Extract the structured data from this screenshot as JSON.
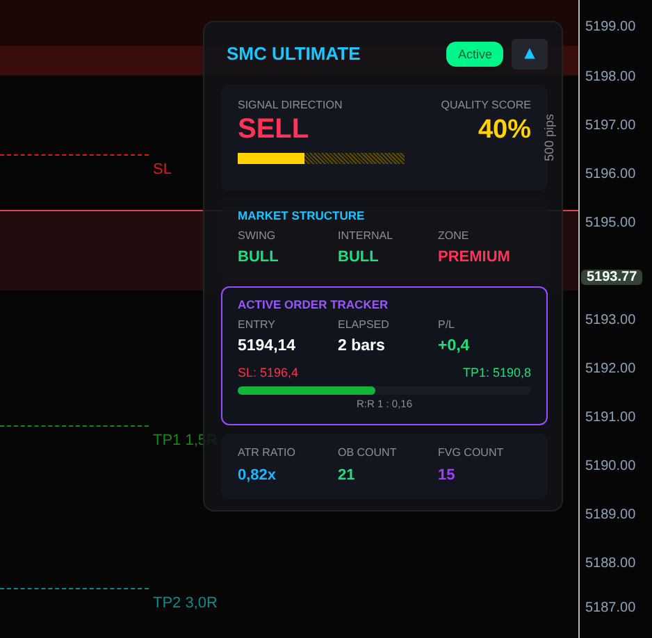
{
  "chart": {
    "price_axis": [
      "5199.00",
      "5198.00",
      "5197.00",
      "5196.00",
      "5195.00",
      "5193.00",
      "5192.00",
      "5191.00",
      "5190.00",
      "5189.00",
      "5188.00",
      "5187.00"
    ],
    "price_tag": "5193.77",
    "levels": [
      {
        "kind": "sl",
        "label": "SL"
      },
      {
        "kind": "tp1",
        "label": "TP1 1,5R"
      },
      {
        "kind": "tp2",
        "label": "TP2 3,0R"
      }
    ],
    "range_label": "500 pips"
  },
  "panel": {
    "title": "SMC ULTIMATE",
    "status": "Active",
    "collapse": "▲",
    "signal": {
      "direction_label": "SIGNAL DIRECTION",
      "direction": "SELL",
      "quality_label": "QUALITY SCORE",
      "quality": "40%",
      "level": 0.4
    },
    "structure": {
      "title": "MARKET STRUCTURE",
      "items": [
        {
          "label": "SWING",
          "value": "BULL",
          "color": "#1fe07a"
        },
        {
          "label": "INTERNAL",
          "value": "BULL",
          "color": "#1fe07a"
        },
        {
          "label": "ZONE",
          "value": "PREMIUM",
          "color": "#ff3355"
        }
      ]
    },
    "tracker": {
      "title": "ACTIVE ORDER TRACKER",
      "items": [
        {
          "label": "ENTRY",
          "value": "5194,14",
          "color": "#ffffff"
        },
        {
          "label": "ELAPSED",
          "value": "2 bars",
          "color": "#ffffff"
        },
        {
          "label": "P/L",
          "value": "+0,4",
          "color": "#1fe07a"
        }
      ],
      "sl": "SL: 5196,4",
      "tp": "TP1: 5190,8",
      "level": 0.47,
      "rr": "R:R  1 : 0,16"
    },
    "stats": [
      {
        "label": "ATR RATIO",
        "value": "0,82x",
        "color": "#19b8ff"
      },
      {
        "label": "OB COUNT",
        "value": "21",
        "color": "#1fe07a"
      },
      {
        "label": "FVG COUNT",
        "value": "15",
        "color": "#a040ff"
      }
    ]
  }
}
